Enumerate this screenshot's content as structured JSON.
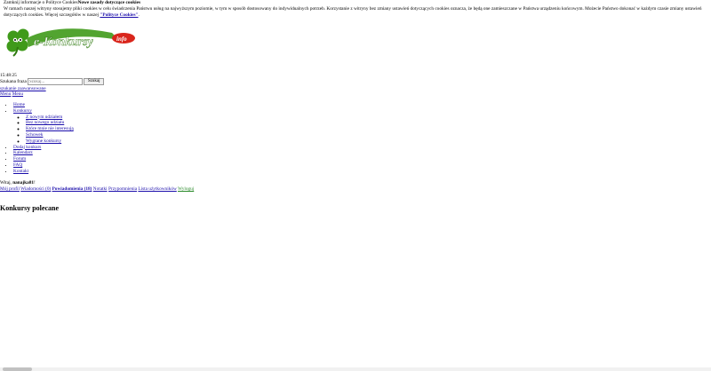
{
  "cookie": {
    "close_label": "Zamknij informacje o Polityce Cookies",
    "title": "Nowe zasady dotyczące cookies",
    "body": "W ramach naszej witryny stosujemy pliki cookies w celu świadczenia Państwu usług na najwyższym poziomie, w tym w sposób dostosowany do indywidualnych potrzeb. Korzystanie z witryny bez zmiany ustawień dotyczących cookies oznacza, że będą one zamieszczane w Państwa urządzeniu końcowym. Możecie Państwo dokonać w każdym czasie zmiany ustawień dotyczących cookies. Więcej szczegółów w naszej",
    "policy_link": "\"Polityce Cookies\"",
    "tail": "."
  },
  "logo": {
    "text": "e-Konkursy",
    "suffix": "info"
  },
  "clock": "15:48:25",
  "search": {
    "label": "Szukana fraza",
    "placeholder": "Szukaj...",
    "button": "Szukaj",
    "advanced_link": "szukanie zaawansowane"
  },
  "menu_links": [
    "Menu",
    "Menu"
  ],
  "nav": {
    "home": "Home",
    "konkursy": "Konkursy",
    "sub": [
      "Z nowym udziałem",
      "Bez nowego udziału",
      "Które mnie nie interesują",
      "Schowek",
      "Wygrane konkursy"
    ],
    "rest": [
      "Dodaj konkurs",
      "Kalendarz",
      "Forum",
      "FAQ",
      "Kontakt"
    ]
  },
  "welcome": {
    "prefix": "Witaj, ",
    "user": "nanajka81",
    "suffix": "!"
  },
  "user_links": {
    "profile": "Mój profil",
    "messages": "Wiadomości (0)",
    "notifications": "Powiadomienia (18)",
    "notes": "Notatki",
    "reminders": "Przypomnienia",
    "users": "Lista użytkowników",
    "logout": "Wyloguj"
  },
  "section_title": "Konkursy polecane",
  "colors": {
    "logo_green": "#3f9a1a",
    "logo_red": "#d9261c",
    "link": "#1a0dab"
  }
}
